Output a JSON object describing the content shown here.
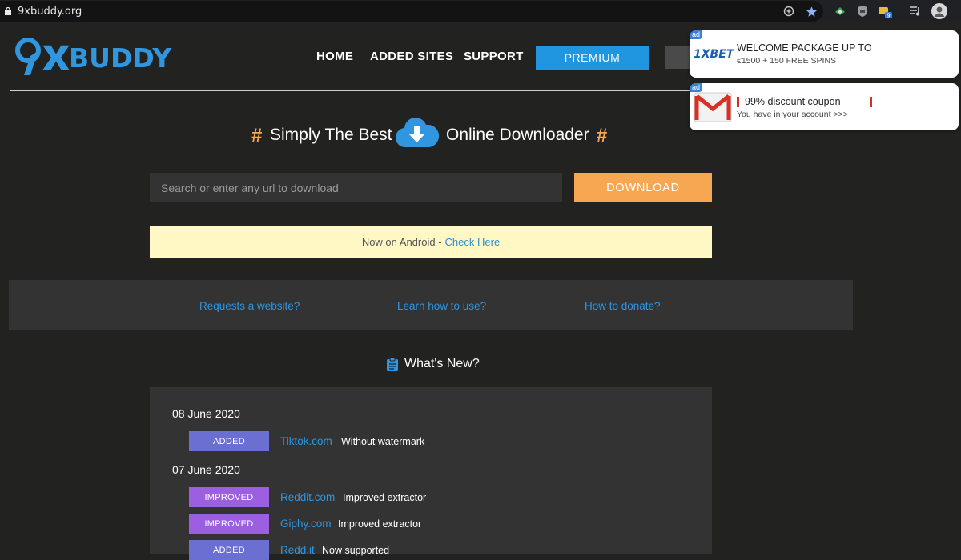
{
  "browser": {
    "url": "9xbuddy.org",
    "extension_badge": "9"
  },
  "header": {
    "logo_text": "9XBUDDY",
    "nav": [
      "HOME",
      "ADDED SITES",
      "SUPPORT"
    ],
    "premium_label": "PREMIUM"
  },
  "notifications": [
    {
      "ad_label": "ad",
      "brand": "1XBET",
      "title": "WELCOME PACKAGE UP TO",
      "subtitle": "€1500 + 150 FREE SPINS"
    },
    {
      "ad_label": "ad",
      "title": "99% discount coupon",
      "subtitle": "You have in your account >>>"
    }
  ],
  "hero": {
    "hash": "#",
    "title_left": "Simply The Best",
    "title_right": "Online Downloader"
  },
  "search": {
    "placeholder": "Search or enter any url to download",
    "button_label": "DOWNLOAD"
  },
  "android_banner": {
    "text": "Now on Android -",
    "link": "Check Here"
  },
  "quick_links": [
    "Requests a website?",
    "Learn how to use?",
    "How to donate?"
  ],
  "whats_new": {
    "title": "What's New?",
    "days": [
      {
        "date": "08 June 2020",
        "items": [
          {
            "status": "ADDED",
            "site": "Tiktok.com",
            "note": "Without watermark"
          }
        ]
      },
      {
        "date": "07 June 2020",
        "items": [
          {
            "status": "IMPROVED",
            "site": "Reddit.com",
            "note": "Improved extractor"
          },
          {
            "status": "IMPROVED",
            "site": "Giphy.com",
            "note": "Improved extractor"
          },
          {
            "status": "ADDED",
            "site": "Redd.it",
            "note": "Now supported"
          }
        ]
      }
    ]
  },
  "colors": {
    "accent_orange": "#f7a752",
    "premium_blue": "#2196e0",
    "link_blue": "#2f96df",
    "added_badge": "#6a6fd1",
    "improved_badge": "#9b5fe0"
  }
}
